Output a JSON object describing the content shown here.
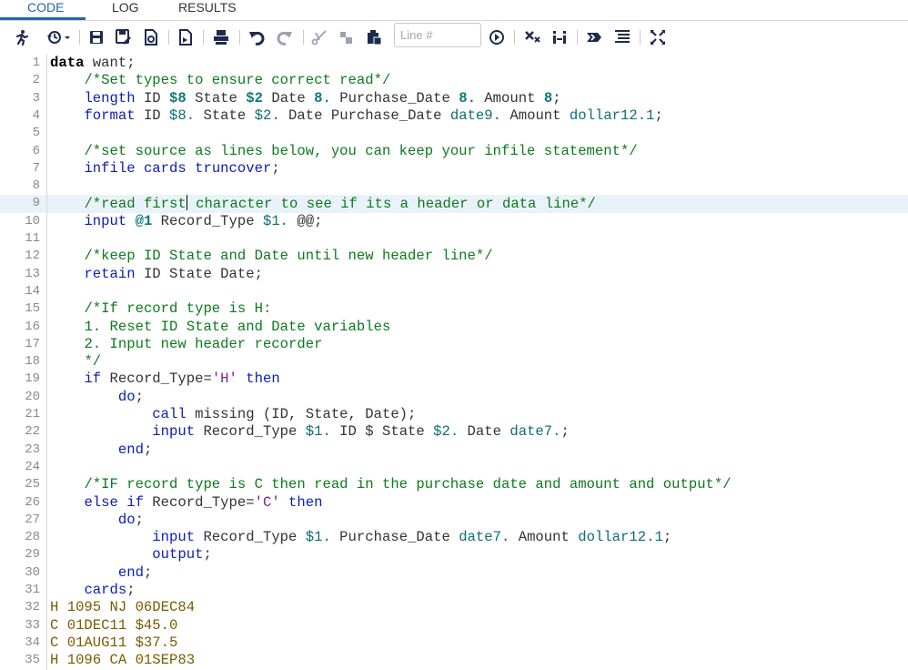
{
  "tabs": [
    {
      "label": "CODE",
      "active": true
    },
    {
      "label": "LOG",
      "active": false
    },
    {
      "label": "RESULTS",
      "active": false
    }
  ],
  "toolbar": {
    "line_placeholder": "Line #",
    "icons": [
      "run-icon",
      "history-icon",
      "save-icon",
      "save-as-icon",
      "download-icon",
      "export-icon",
      "print-icon",
      "undo-icon",
      "redo-icon",
      "cut-icon",
      "copy-icon",
      "paste-icon",
      "go-icon",
      "clear-icon",
      "format-icon",
      "submit-selection-icon",
      "outline-icon",
      "maximize-icon"
    ]
  },
  "colors": {
    "accent": "#2266b0",
    "keyword": "#0b1cb8",
    "comment": "#0c7a1c",
    "format": "#0c6d76",
    "string": "#8a1c8a",
    "datalines": "#7a5b00"
  },
  "editor": {
    "current_line": 9,
    "lines": [
      [
        [
          "kwb",
          "data"
        ],
        [
          "plain",
          " want;"
        ]
      ],
      [
        [
          "plain",
          "    "
        ],
        [
          "cm",
          "/*Set types to ensure correct read*/"
        ]
      ],
      [
        [
          "plain",
          "    "
        ],
        [
          "kw",
          "length"
        ],
        [
          "plain",
          " ID "
        ],
        [
          "num",
          "$8"
        ],
        [
          "plain",
          " State "
        ],
        [
          "num",
          "$2"
        ],
        [
          "plain",
          " Date "
        ],
        [
          "num",
          "8."
        ],
        [
          "plain",
          " Purchase_Date "
        ],
        [
          "num",
          "8."
        ],
        [
          "plain",
          " Amount "
        ],
        [
          "num",
          "8"
        ],
        [
          "plain",
          ";"
        ]
      ],
      [
        [
          "plain",
          "    "
        ],
        [
          "kw",
          "format"
        ],
        [
          "plain",
          " ID "
        ],
        [
          "fmt",
          "$8."
        ],
        [
          "plain",
          " State "
        ],
        [
          "fmt",
          "$2."
        ],
        [
          "plain",
          " Date Purchase_Date "
        ],
        [
          "fmt",
          "date9."
        ],
        [
          "plain",
          " Amount "
        ],
        [
          "fmt",
          "dollar12.1"
        ],
        [
          "plain",
          ";"
        ]
      ],
      [],
      [
        [
          "plain",
          "    "
        ],
        [
          "cm",
          "/*set source as lines below, you can keep your infile statement*/"
        ]
      ],
      [
        [
          "plain",
          "    "
        ],
        [
          "kw",
          "infile"
        ],
        [
          "plain",
          " "
        ],
        [
          "kw",
          "cards truncover"
        ],
        [
          "plain",
          ";"
        ]
      ],
      [],
      [
        [
          "plain",
          "    "
        ],
        [
          "cm",
          "/*read first"
        ],
        [
          "cursor",
          ""
        ],
        [
          "cm",
          " character to see if its a header or data line*/"
        ]
      ],
      [
        [
          "plain",
          "    "
        ],
        [
          "kw",
          "input"
        ],
        [
          "plain",
          " "
        ],
        [
          "num",
          "@1"
        ],
        [
          "plain",
          " Record_Type "
        ],
        [
          "fmt",
          "$1."
        ],
        [
          "plain",
          " @@;"
        ]
      ],
      [],
      [
        [
          "plain",
          "    "
        ],
        [
          "cm",
          "/*keep ID State and Date until new header line*/"
        ]
      ],
      [
        [
          "plain",
          "    "
        ],
        [
          "kw",
          "retain"
        ],
        [
          "plain",
          " ID State Date;"
        ]
      ],
      [],
      [
        [
          "plain",
          "    "
        ],
        [
          "cm",
          "/*If record type is H:"
        ]
      ],
      [
        [
          "plain",
          "    "
        ],
        [
          "cm",
          "1. Reset ID State and Date variables"
        ]
      ],
      [
        [
          "plain",
          "    "
        ],
        [
          "cm",
          "2. Input new header recorder"
        ]
      ],
      [
        [
          "plain",
          "    "
        ],
        [
          "cm",
          "*/"
        ]
      ],
      [
        [
          "plain",
          "    "
        ],
        [
          "kw",
          "if"
        ],
        [
          "plain",
          " Record_Type="
        ],
        [
          "str",
          "'H'"
        ],
        [
          "plain",
          " "
        ],
        [
          "kw",
          "then"
        ]
      ],
      [
        [
          "plain",
          "        "
        ],
        [
          "kw",
          "do"
        ],
        [
          "plain",
          ";"
        ]
      ],
      [
        [
          "plain",
          "            "
        ],
        [
          "kw",
          "call"
        ],
        [
          "plain",
          " missing (ID, State, Date);"
        ]
      ],
      [
        [
          "plain",
          "            "
        ],
        [
          "kw",
          "input"
        ],
        [
          "plain",
          " Record_Type "
        ],
        [
          "fmt",
          "$1."
        ],
        [
          "plain",
          " ID $ State "
        ],
        [
          "fmt",
          "$2."
        ],
        [
          "plain",
          " Date "
        ],
        [
          "fmt",
          "date7."
        ],
        [
          "plain",
          ";"
        ]
      ],
      [
        [
          "plain",
          "        "
        ],
        [
          "kw",
          "end"
        ],
        [
          "plain",
          ";"
        ]
      ],
      [],
      [
        [
          "plain",
          "    "
        ],
        [
          "cm",
          "/*IF record type is C then read in the purchase date and amount and output*/"
        ]
      ],
      [
        [
          "plain",
          "    "
        ],
        [
          "kw",
          "else if"
        ],
        [
          "plain",
          " Record_Type="
        ],
        [
          "str",
          "'C'"
        ],
        [
          "plain",
          " "
        ],
        [
          "kw",
          "then"
        ]
      ],
      [
        [
          "plain",
          "        "
        ],
        [
          "kw",
          "do"
        ],
        [
          "plain",
          ";"
        ]
      ],
      [
        [
          "plain",
          "            "
        ],
        [
          "kw",
          "input"
        ],
        [
          "plain",
          " Record_Type "
        ],
        [
          "fmt",
          "$1."
        ],
        [
          "plain",
          " Purchase_Date "
        ],
        [
          "fmt",
          "date7."
        ],
        [
          "plain",
          " Amount "
        ],
        [
          "fmt",
          "dollar12.1"
        ],
        [
          "plain",
          ";"
        ]
      ],
      [
        [
          "plain",
          "            "
        ],
        [
          "kw",
          "output"
        ],
        [
          "plain",
          ";"
        ]
      ],
      [
        [
          "plain",
          "        "
        ],
        [
          "kw",
          "end"
        ],
        [
          "plain",
          ";"
        ]
      ],
      [
        [
          "plain",
          "    "
        ],
        [
          "kw",
          "cards"
        ],
        [
          "plain",
          ";"
        ]
      ],
      [
        [
          "dat",
          "H 1095 NJ 06DEC84"
        ]
      ],
      [
        [
          "dat",
          "C 01DEC11 $45.0"
        ]
      ],
      [
        [
          "dat",
          "C 01AUG11 $37.5"
        ]
      ],
      [
        [
          "dat",
          "H 1096 CA 01SEP83"
        ]
      ]
    ]
  }
}
